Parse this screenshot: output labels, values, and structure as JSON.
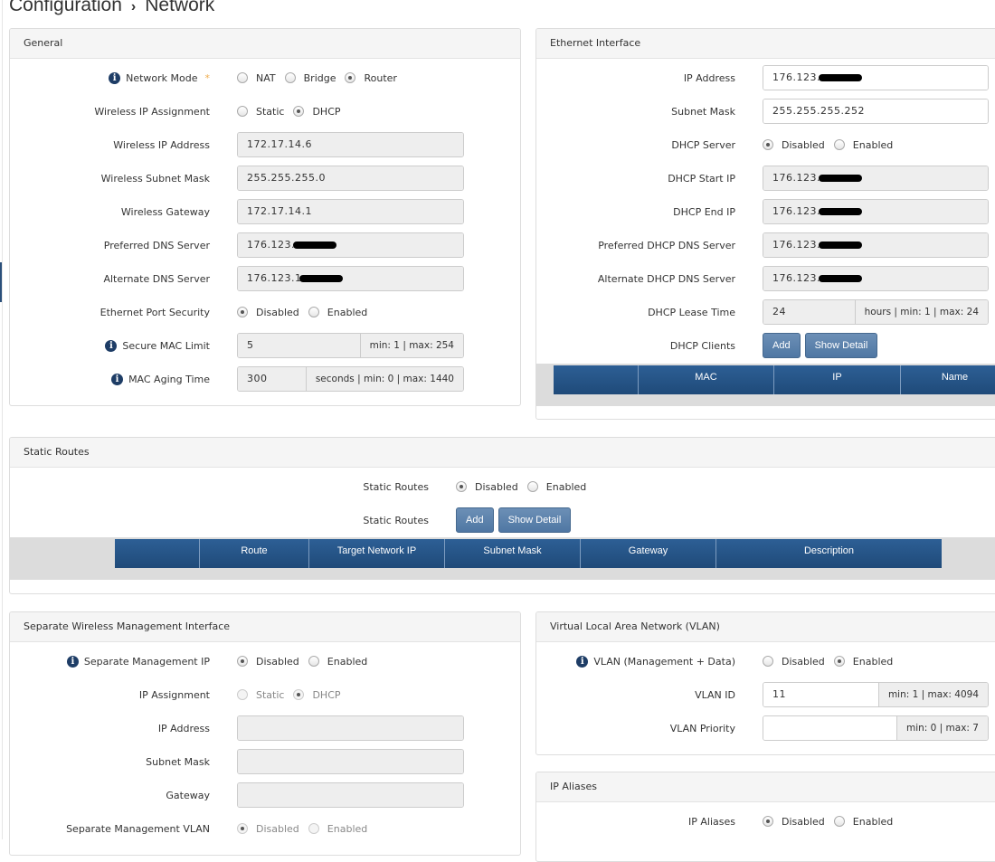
{
  "breadcrumb": {
    "root": "Configuration",
    "current": "Network"
  },
  "panels": {
    "general": {
      "title": "General",
      "rows": [
        {
          "label": "Network Mode",
          "info": true,
          "required": "*",
          "type": "radio",
          "options": [
            "NAT",
            "Bridge",
            "Router"
          ],
          "selected": 2
        },
        {
          "label": "Wireless IP Assignment",
          "type": "radio",
          "options": [
            "Static",
            "DHCP"
          ],
          "selected": 1
        },
        {
          "label": "Wireless IP Address",
          "type": "input",
          "value": "172.17.14.6"
        },
        {
          "label": "Wireless Subnet Mask",
          "type": "input",
          "value": "255.255.255.0"
        },
        {
          "label": "Wireless Gateway",
          "type": "input",
          "value": "172.17.14.1"
        },
        {
          "label": "Preferred DNS Server",
          "type": "input",
          "value": "176.123.",
          "redacted": true
        },
        {
          "label": "Alternate DNS Server",
          "type": "input",
          "value": "176.123.1",
          "redacted": true
        },
        {
          "label": "Ethernet Port Security",
          "type": "radio",
          "options": [
            "Disabled",
            "Enabled"
          ],
          "selected": 0
        },
        {
          "label": "Secure MAC Limit",
          "info": true,
          "type": "input",
          "value": "5",
          "addon": "min: 1 | max: 254"
        },
        {
          "label": "MAC Aging Time",
          "info": true,
          "type": "input",
          "value": "300",
          "addon": "seconds | min: 0 | max: 1440"
        }
      ]
    },
    "ethernet": {
      "title": "Ethernet Interface",
      "rows": [
        {
          "label": "IP Address",
          "type": "input",
          "value": "176.123.",
          "redacted": true,
          "editable": true
        },
        {
          "label": "Subnet Mask",
          "type": "input",
          "value": "255.255.255.252",
          "editable": true
        },
        {
          "label": "DHCP Server",
          "type": "radio",
          "options": [
            "Disabled",
            "Enabled"
          ],
          "selected": 0
        },
        {
          "label": "DHCP Start IP",
          "type": "input",
          "value": "176.123.",
          "redacted": true
        },
        {
          "label": "DHCP End IP",
          "type": "input",
          "value": "176.123.",
          "redacted": true
        },
        {
          "label": "Preferred DHCP DNS Server",
          "type": "input",
          "value": "176.123.",
          "redacted": true
        },
        {
          "label": "Alternate DHCP DNS Server",
          "type": "input",
          "value": "176.123.",
          "redacted": true
        },
        {
          "label": "DHCP Lease Time",
          "type": "input",
          "value": "24",
          "addon": "hours | min: 1 | max: 24"
        },
        {
          "label": "DHCP Clients",
          "type": "buttons",
          "buttons": [
            "Add",
            "Show Detail"
          ]
        }
      ],
      "table_columns": [
        "",
        "MAC",
        "IP",
        "Name"
      ]
    },
    "static_routes": {
      "title": "Static Routes",
      "rows": [
        {
          "label": "Static Routes",
          "type": "radio",
          "options": [
            "Disabled",
            "Enabled"
          ],
          "selected": 0
        },
        {
          "label": "Static Routes",
          "type": "buttons",
          "buttons": [
            "Add",
            "Show Detail"
          ]
        }
      ],
      "table_columns": [
        "",
        "Route",
        "Target Network IP",
        "Subnet Mask",
        "Gateway",
        "Description"
      ]
    },
    "mgmt": {
      "title": "Separate Wireless Management Interface",
      "rows": [
        {
          "label": "Separate Management IP",
          "info": true,
          "type": "radio",
          "options": [
            "Disabled",
            "Enabled"
          ],
          "selected": 0
        },
        {
          "label": "IP Assignment",
          "type": "radio",
          "options": [
            "Static",
            "DHCP"
          ],
          "selected": 1,
          "disabled": true
        },
        {
          "label": "IP Address",
          "type": "input",
          "value": ""
        },
        {
          "label": "Subnet Mask",
          "type": "input",
          "value": ""
        },
        {
          "label": "Gateway",
          "type": "input",
          "value": ""
        },
        {
          "label": "Separate Management VLAN",
          "type": "radio",
          "options": [
            "Disabled",
            "Enabled"
          ],
          "selected": 0,
          "disabled": true
        }
      ]
    },
    "vlan": {
      "title": "Virtual Local Area Network (VLAN)",
      "rows": [
        {
          "label": "VLAN (Management + Data)",
          "info": true,
          "type": "radio",
          "options": [
            "Disabled",
            "Enabled"
          ],
          "selected": 1
        },
        {
          "label": "VLAN ID",
          "type": "input",
          "value": "11",
          "addon": "min: 1 | max: 4094",
          "editable": true
        },
        {
          "label": "VLAN Priority",
          "type": "input",
          "value": "",
          "addon": "min: 0 | max: 7",
          "editable": true
        }
      ]
    },
    "aliases": {
      "title": "IP Aliases",
      "rows": [
        {
          "label": "IP Aliases",
          "type": "radio",
          "options": [
            "Disabled",
            "Enabled"
          ],
          "selected": 0
        }
      ]
    }
  },
  "colors": {
    "table_header": "#2d5f95",
    "button": "#5b80aa",
    "info_icon": "#1e3d66",
    "required": "#f0ad4e"
  }
}
